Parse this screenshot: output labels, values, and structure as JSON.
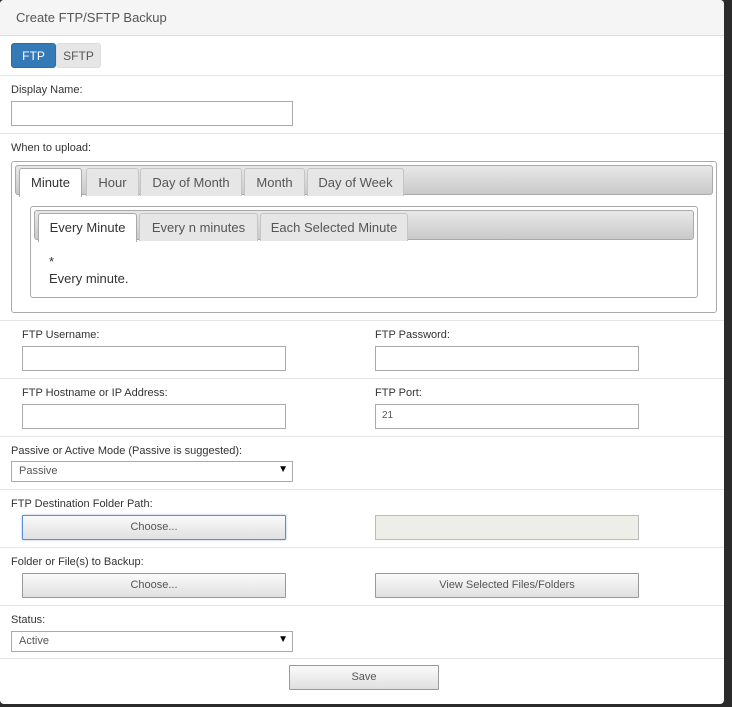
{
  "header": {
    "title": "Create FTP/SFTP Backup"
  },
  "protocol": {
    "ftp_label": "FTP",
    "sftp_label": "SFTP",
    "selected": "FTP"
  },
  "display_name": {
    "label": "Display Name:",
    "value": ""
  },
  "schedule": {
    "label": "When to upload:",
    "tabs": [
      {
        "label": "Minute",
        "active": true
      },
      {
        "label": "Hour",
        "active": false
      },
      {
        "label": "Day of Month",
        "active": false
      },
      {
        "label": "Month",
        "active": false
      },
      {
        "label": "Day of Week",
        "active": false
      }
    ],
    "subtabs": [
      {
        "label": "Every Minute",
        "active": true
      },
      {
        "label": "Every n minutes",
        "active": false
      },
      {
        "label": "Each Selected Minute",
        "active": false
      }
    ],
    "expression": "*",
    "description": "Every minute."
  },
  "credentials": {
    "username_label": "FTP Username:",
    "username_value": "",
    "password_label": "FTP Password:",
    "password_value": ""
  },
  "host": {
    "hostname_label": "FTP Hostname or IP Address:",
    "hostname_value": "",
    "port_label": "FTP Port:",
    "port_value": "21"
  },
  "mode": {
    "label": "Passive or Active Mode (Passive is suggested):",
    "selected": "Passive"
  },
  "destination": {
    "label": "FTP Destination Folder Path:",
    "choose_label": "Choose...",
    "path_value": ""
  },
  "source": {
    "label": "Folder or File(s) to Backup:",
    "choose_label": "Choose...",
    "view_label": "View Selected Files/Folders"
  },
  "status": {
    "label": "Status:",
    "selected": "Active"
  },
  "actions": {
    "save_label": "Save"
  },
  "icons": {
    "dropdown": "chevron-down-icon"
  }
}
